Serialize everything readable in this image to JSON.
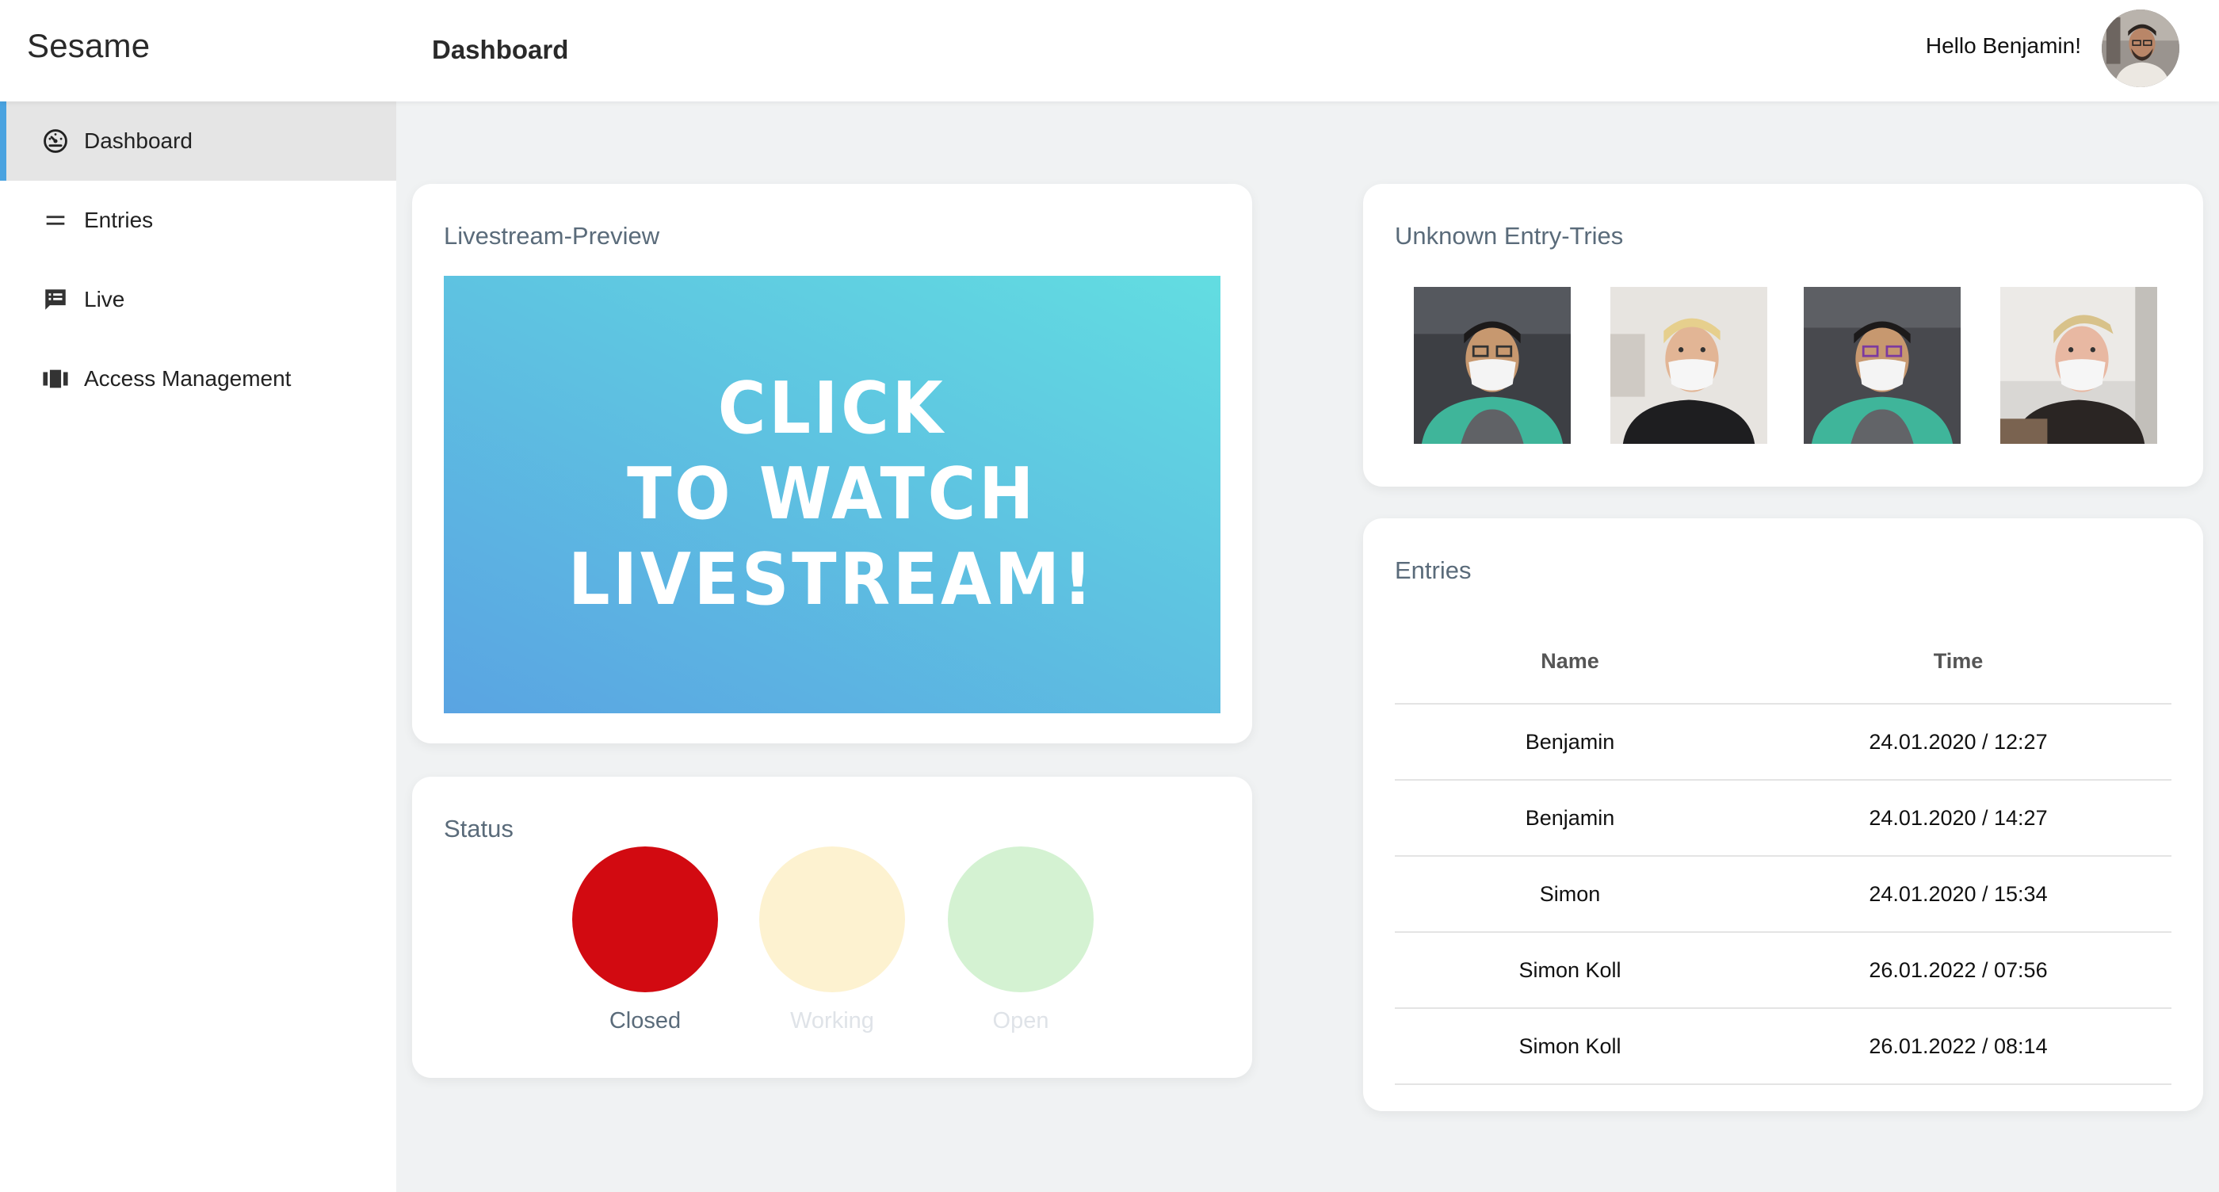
{
  "app": {
    "brand": "Sesame"
  },
  "header": {
    "page_title": "Dashboard",
    "greeting": "Hello Benjamin!"
  },
  "sidebar": {
    "items": [
      {
        "label": "Dashboard",
        "icon": "speedometer-icon",
        "active": true
      },
      {
        "label": "Entries",
        "icon": "equals-icon",
        "active": false
      },
      {
        "label": "Live",
        "icon": "chat-list-icon",
        "active": false
      },
      {
        "label": "Access Management",
        "icon": "view-columns-icon",
        "active": false
      }
    ]
  },
  "livestream": {
    "title": "Livestream-Preview",
    "banner_lines": [
      "CLICK",
      "TO WATCH",
      "LIVESTREAM!"
    ]
  },
  "status": {
    "title": "Status",
    "states": [
      {
        "label": "Closed",
        "color": "#d20a11",
        "label_color": "#5a6b7a",
        "active": true
      },
      {
        "label": "Working",
        "color": "#fdf2d0",
        "label_color": "#dfe3e8",
        "active": false
      },
      {
        "label": "Open",
        "color": "#d4f2d2",
        "label_color": "#dfe3e8",
        "active": false
      }
    ]
  },
  "unknown_entries": {
    "title": "Unknown Entry-Tries",
    "photos": [
      {
        "icon": "masked-person-photo-1"
      },
      {
        "icon": "masked-person-photo-2"
      },
      {
        "icon": "masked-person-photo-3"
      },
      {
        "icon": "masked-person-photo-4"
      }
    ]
  },
  "entries": {
    "title": "Entries",
    "columns": [
      "Name",
      "Time"
    ],
    "rows": [
      {
        "name": "Benjamin",
        "time": "24.01.2020 / 12:27"
      },
      {
        "name": "Benjamin",
        "time": "24.01.2020 / 14:27"
      },
      {
        "name": "Simon",
        "time": "24.01.2020 / 15:34"
      },
      {
        "name": "Simon Koll",
        "time": "26.01.2022 / 07:56"
      },
      {
        "name": "Simon Koll",
        "time": "26.01.2022 / 08:14"
      }
    ]
  },
  "colors": {
    "accent": "#4aa3e0",
    "banner_start": "#5aa4e2",
    "banner_end": "#62dde1"
  }
}
